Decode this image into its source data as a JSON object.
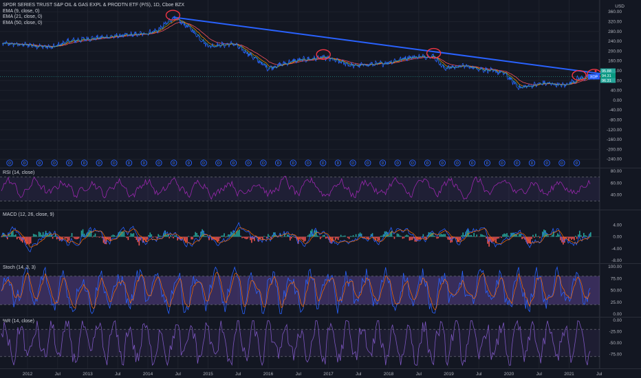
{
  "header": {
    "title": "SPDR SERIES TRUST S&P OIL & GAS EXPL & PRODTN ETF (P/S), 1D, Cboe BZX",
    "indicators": [
      "EMA (9, close, 0)",
      "EMA (21, close, 0)",
      "EMA (50, close, 0)"
    ],
    "currency": "USD"
  },
  "price_tag": {
    "symbol": "XOP",
    "prices": [
      "95.88",
      "94.31",
      "96.31"
    ],
    "color": "#26a69a"
  },
  "panes": {
    "rsi_label": "RSI (14, close)",
    "macd_label": "MACD (12, 26, close, 9)",
    "stoch_label": "Stoch (14, 3, 3)",
    "wr_label": "%R (14, close)"
  },
  "dividend_marker": "D",
  "colors": {
    "background": "#131722",
    "price_line": "#2962ff",
    "trendline": "#2962ff",
    "circle": "#f23645",
    "rsi": "#9c27b0",
    "stoch_k": "#2962ff",
    "stoch_d": "#ff6d00",
    "wr": "#7e57c2",
    "macd_up": "#26a69a",
    "macd_down": "#ef5350"
  },
  "chart_data": {
    "type": "line",
    "x_axis_labels": [
      "2012",
      "Jul",
      "2013",
      "Jul",
      "2014",
      "Jul",
      "2015",
      "Jul",
      "2016",
      "Jul",
      "2017",
      "Jul",
      "2018",
      "Jul",
      "2019",
      "Jul",
      "2020",
      "Jul",
      "2021",
      "Jul"
    ],
    "main": {
      "ylim": [
        -280,
        380
      ],
      "y_ticks": [
        "360.00",
        "320.00",
        "280.00",
        "240.00",
        "200.00",
        "160.00",
        "120.00",
        "80.00",
        "40.00",
        "0.00",
        "-40.00",
        "-80.00",
        "-120.00",
        "-160.00",
        "-200.00",
        "-240.00"
      ],
      "price_series_points": [
        [
          "2011-08",
          230
        ],
        [
          "2012-01",
          225
        ],
        [
          "2012-06",
          215
        ],
        [
          "2012-09",
          240
        ],
        [
          "2013-01",
          250
        ],
        [
          "2013-06",
          260
        ],
        [
          "2013-12",
          270
        ],
        [
          "2014-03",
          285
        ],
        [
          "2014-06",
          335
        ],
        [
          "2014-09",
          300
        ],
        [
          "2015-01",
          220
        ],
        [
          "2015-06",
          230
        ],
        [
          "2015-09",
          190
        ],
        [
          "2016-01",
          130
        ],
        [
          "2016-06",
          160
        ],
        [
          "2016-12",
          175
        ],
        [
          "2017-06",
          140
        ],
        [
          "2017-12",
          150
        ],
        [
          "2018-05",
          175
        ],
        [
          "2018-10",
          180
        ],
        [
          "2018-12",
          130
        ],
        [
          "2019-04",
          140
        ],
        [
          "2019-12",
          110
        ],
        [
          "2020-03",
          50
        ],
        [
          "2020-08",
          70
        ],
        [
          "2020-12",
          60
        ],
        [
          "2021-03",
          90
        ],
        [
          "2021-06",
          95
        ]
      ],
      "trendline": [
        [
          "2014-06",
          338
        ],
        [
          "2021-06",
          95
        ]
      ],
      "circles": [
        "2014-06",
        "2016-12",
        "2018-10",
        "2021-03",
        "2021-06"
      ]
    },
    "rsi": {
      "ylim": [
        20,
        80
      ],
      "y_ticks": [
        "80.00",
        "60.00",
        "40.00"
      ],
      "band": [
        30,
        70
      ]
    },
    "macd": {
      "ylim": [
        -8,
        8
      ],
      "y_ticks": [
        "4.00",
        "0.00",
        "-4.00",
        "-8.00"
      ]
    },
    "stoch": {
      "ylim": [
        0,
        100
      ],
      "y_ticks": [
        "100.00",
        "75.00",
        "50.00",
        "25.00",
        "0.00"
      ],
      "band": [
        20,
        80
      ]
    },
    "wr": {
      "ylim": [
        -100,
        0
      ],
      "y_ticks": [
        "0.00",
        "-25.00",
        "-50.00",
        "-75.00"
      ],
      "band": [
        -80,
        -20
      ]
    }
  }
}
